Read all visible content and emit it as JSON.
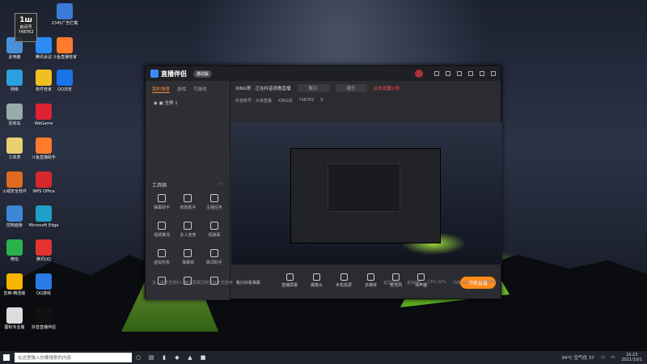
{
  "desktop": {
    "icons": [
      {
        "label": "房间号",
        "color": "#e0a030"
      },
      {
        "label": "2345广告拦截",
        "color": "#3a7bd5"
      },
      {
        "label": "此电脑",
        "color": "#4a90d9"
      },
      {
        "label": "腾讯会议",
        "color": "#2c8cf4"
      },
      {
        "label": "斗鱼直播管家",
        "color": "#ff7a2a"
      },
      {
        "label": "网络",
        "color": "#2aa0e0"
      },
      {
        "label": "软件管家",
        "color": "#f0c020"
      },
      {
        "label": "QQ浏览",
        "color": "#1a73e8"
      },
      {
        "label": "回收站",
        "color": "#9aa"
      },
      {
        "label": "WeGame",
        "color": "#d23"
      },
      {
        "label": "工资表",
        "color": "#e8d070"
      },
      {
        "label": "斗鱼直播助手",
        "color": "#ff7a2a"
      },
      {
        "label": "火绒安全软件",
        "color": "#e06a20"
      },
      {
        "label": "WPS Office",
        "color": "#d6282c"
      },
      {
        "label": "控制面板",
        "color": "#3c87d6"
      },
      {
        "label": "Microsoft Edge",
        "color": "#1fa0c8"
      },
      {
        "label": "微信",
        "color": "#2bb24c"
      },
      {
        "label": "腾讯QQ",
        "color": "#e3342f"
      },
      {
        "label": "剪映-精选版",
        "color": "#f6b400"
      },
      {
        "label": "QQ游戏",
        "color": "#2a7be4"
      },
      {
        "label": "图标专业版",
        "color": "#ddd"
      },
      {
        "label": "抖音直播伴侣",
        "color": "#111"
      }
    ],
    "badge": {
      "top": "1ш",
      "label": "房间号",
      "num": "748762"
    }
  },
  "app": {
    "brand": "直播伴侣",
    "beta": "测试版",
    "tabs": [
      "我的场景",
      "游戏",
      "可游戏"
    ],
    "scene": "全屏 1",
    "tools_header": "工具箱",
    "tools": [
      "弹幕助手",
      "房管助手",
      "主播任务",
      "视频推流",
      "多人连麦",
      "观弹幕",
      "虚拟形象",
      "弹幕窗",
      "歌词助手",
      "",
      "",
      ""
    ],
    "room": {
      "title": "XING哥 · 正在抖音观看直播",
      "sel": "聊天",
      "sel2": "娱乐",
      "alert": "点击直播公告"
    },
    "room2": {
      "account": "抖音账号 · 大侠直播",
      "id": "XING哥",
      "num": "748762",
      "likes": "0"
    },
    "controls": [
      "直播屏幕",
      "摄像头",
      "手机投屏",
      "多媒体",
      "麦克风",
      "扬声器"
    ],
    "start": "开始直播",
    "status_left": "多人连麦支持6人,两个屏幕同时显示正式使用",
    "status_link": "我只好看弹幕",
    "status_right": [
      "延迟0ms",
      "丢帧0%",
      "CPU 22%",
      "内存 46%",
      "00:00:00"
    ]
  },
  "taskbar": {
    "search": "在这里输入你要搜索的内容",
    "weather": "34°C 空气优 37",
    "time": "16:23",
    "date": "2021/10/1"
  }
}
